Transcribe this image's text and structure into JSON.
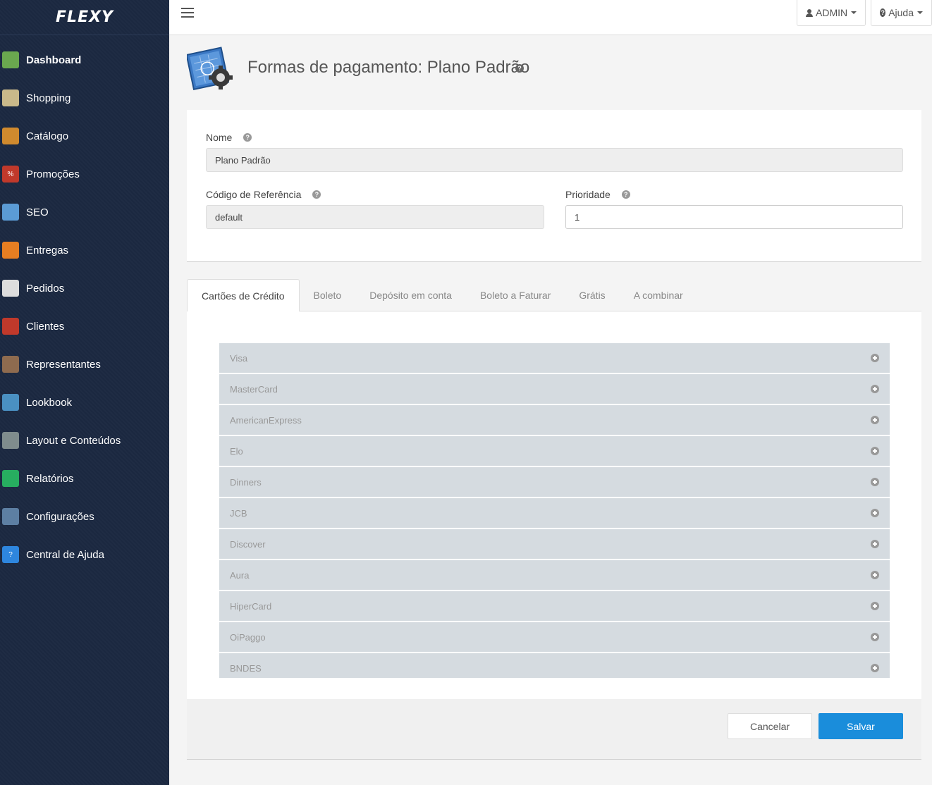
{
  "brand": {
    "logo_text": "FLEXY"
  },
  "sidebar": {
    "items": [
      {
        "label": "Dashboard",
        "icon": "dashboard-icon",
        "color": "#6aa84f"
      },
      {
        "label": "Shopping",
        "icon": "shopping-icon",
        "color": "#c9b98a"
      },
      {
        "label": "Catálogo",
        "icon": "catalog-icon",
        "color": "#d08a2e"
      },
      {
        "label": "Promoções",
        "icon": "promotions-icon",
        "color": "#c0392b"
      },
      {
        "label": "SEO",
        "icon": "seo-icon",
        "color": "#5b9bd5"
      },
      {
        "label": "Entregas",
        "icon": "delivery-icon",
        "color": "#e67e22"
      },
      {
        "label": "Pedidos",
        "icon": "orders-icon",
        "color": "#dddddd"
      },
      {
        "label": "Clientes",
        "icon": "clients-icon",
        "color": "#c0392b"
      },
      {
        "label": "Representantes",
        "icon": "representatives-icon",
        "color": "#8e6b4f"
      },
      {
        "label": "Lookbook",
        "icon": "lookbook-icon",
        "color": "#4a90c2"
      },
      {
        "label": "Layout e Conteúdos",
        "icon": "layout-icon",
        "color": "#7f8c8d"
      },
      {
        "label": "Relatórios",
        "icon": "reports-icon",
        "color": "#27ae60"
      },
      {
        "label": "Configurações",
        "icon": "settings-icon",
        "color": "#5d7fa3"
      },
      {
        "label": "Central de Ajuda",
        "icon": "help-center-icon",
        "color": "#2e86de"
      }
    ]
  },
  "topbar": {
    "user_label": "ADMIN",
    "help_label": "Ajuda"
  },
  "page": {
    "title": "Formas de pagamento: Plano Padrão"
  },
  "form": {
    "name_label": "Nome",
    "name_value": "Plano Padrão",
    "ref_label": "Código de Referência",
    "ref_value": "default",
    "priority_label": "Prioridade",
    "priority_value": "1"
  },
  "tabs": [
    "Cartões de Crédito",
    "Boleto",
    "Depósito em conta",
    "Boleto a Faturar",
    "Grátis",
    "A combinar"
  ],
  "cards": [
    "Visa",
    "MasterCard",
    "AmericanExpress",
    "Elo",
    "Dinners",
    "JCB",
    "Discover",
    "Aura",
    "HiperCard",
    "OiPaggo",
    "BNDES"
  ],
  "footer": {
    "cancel_label": "Cancelar",
    "save_label": "Salvar"
  },
  "colors": {
    "sidebar_bg": "#1b2840",
    "primary": "#1a8ddb",
    "card_row_bg": "#d5dbe0"
  }
}
